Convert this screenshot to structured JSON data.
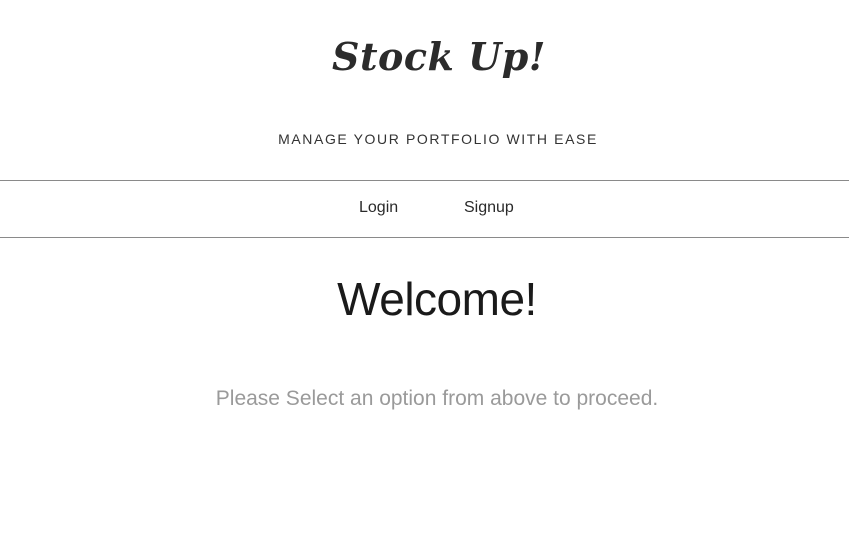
{
  "header": {
    "brand": "Stock Up!",
    "tagline": "MANAGE YOUR PORTFOLIO WITH EASE"
  },
  "nav": {
    "items": [
      {
        "label": "Login"
      },
      {
        "label": "Signup"
      }
    ]
  },
  "main": {
    "heading": "Welcome!",
    "instruction": "Please Select an option from above to proceed."
  }
}
